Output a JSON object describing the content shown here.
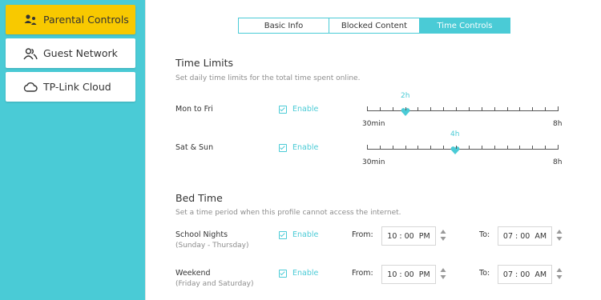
{
  "sidebar": {
    "items": [
      {
        "label": "Parental Controls",
        "icon": "family-icon",
        "active": true
      },
      {
        "label": "Guest Network",
        "icon": "guest-users-icon",
        "active": false
      },
      {
        "label": "TP-Link Cloud",
        "icon": "cloud-icon",
        "active": false
      }
    ]
  },
  "tabs": [
    {
      "label": "Basic Info",
      "active": false
    },
    {
      "label": "Blocked Content",
      "active": false
    },
    {
      "label": "Time Controls",
      "active": true
    }
  ],
  "time_limits": {
    "title": "Time Limits",
    "description": "Set daily time limits for the total time spent online.",
    "rows": [
      {
        "label": "Mon to Fri",
        "enable_label": "Enable",
        "enabled": true,
        "value": "2h",
        "min": "30min",
        "max": "8h"
      },
      {
        "label": "Sat & Sun",
        "enable_label": "Enable",
        "enabled": true,
        "value": "4h",
        "min": "30min",
        "max": "8h"
      }
    ]
  },
  "bed_time": {
    "title": "Bed Time",
    "description": "Set a time period when this profile cannot access the internet.",
    "rows": [
      {
        "label": "School Nights",
        "sublabel": "(Sunday - Thursday)",
        "enable_label": "Enable",
        "enabled": true,
        "from_label": "From:",
        "from_value": "10 : 00  PM",
        "to_label": "To:",
        "to_value": "07 : 00  AM"
      },
      {
        "label": "Weekend",
        "sublabel": "(Friday and Saturday)",
        "enable_label": "Enable",
        "enabled": true,
        "from_label": "From:",
        "from_value": "10 : 00  PM",
        "to_label": "To:",
        "to_value": "07 : 00  AM"
      }
    ]
  },
  "colors": {
    "accent": "#4acbd6",
    "active_nav": "#f8c900"
  }
}
